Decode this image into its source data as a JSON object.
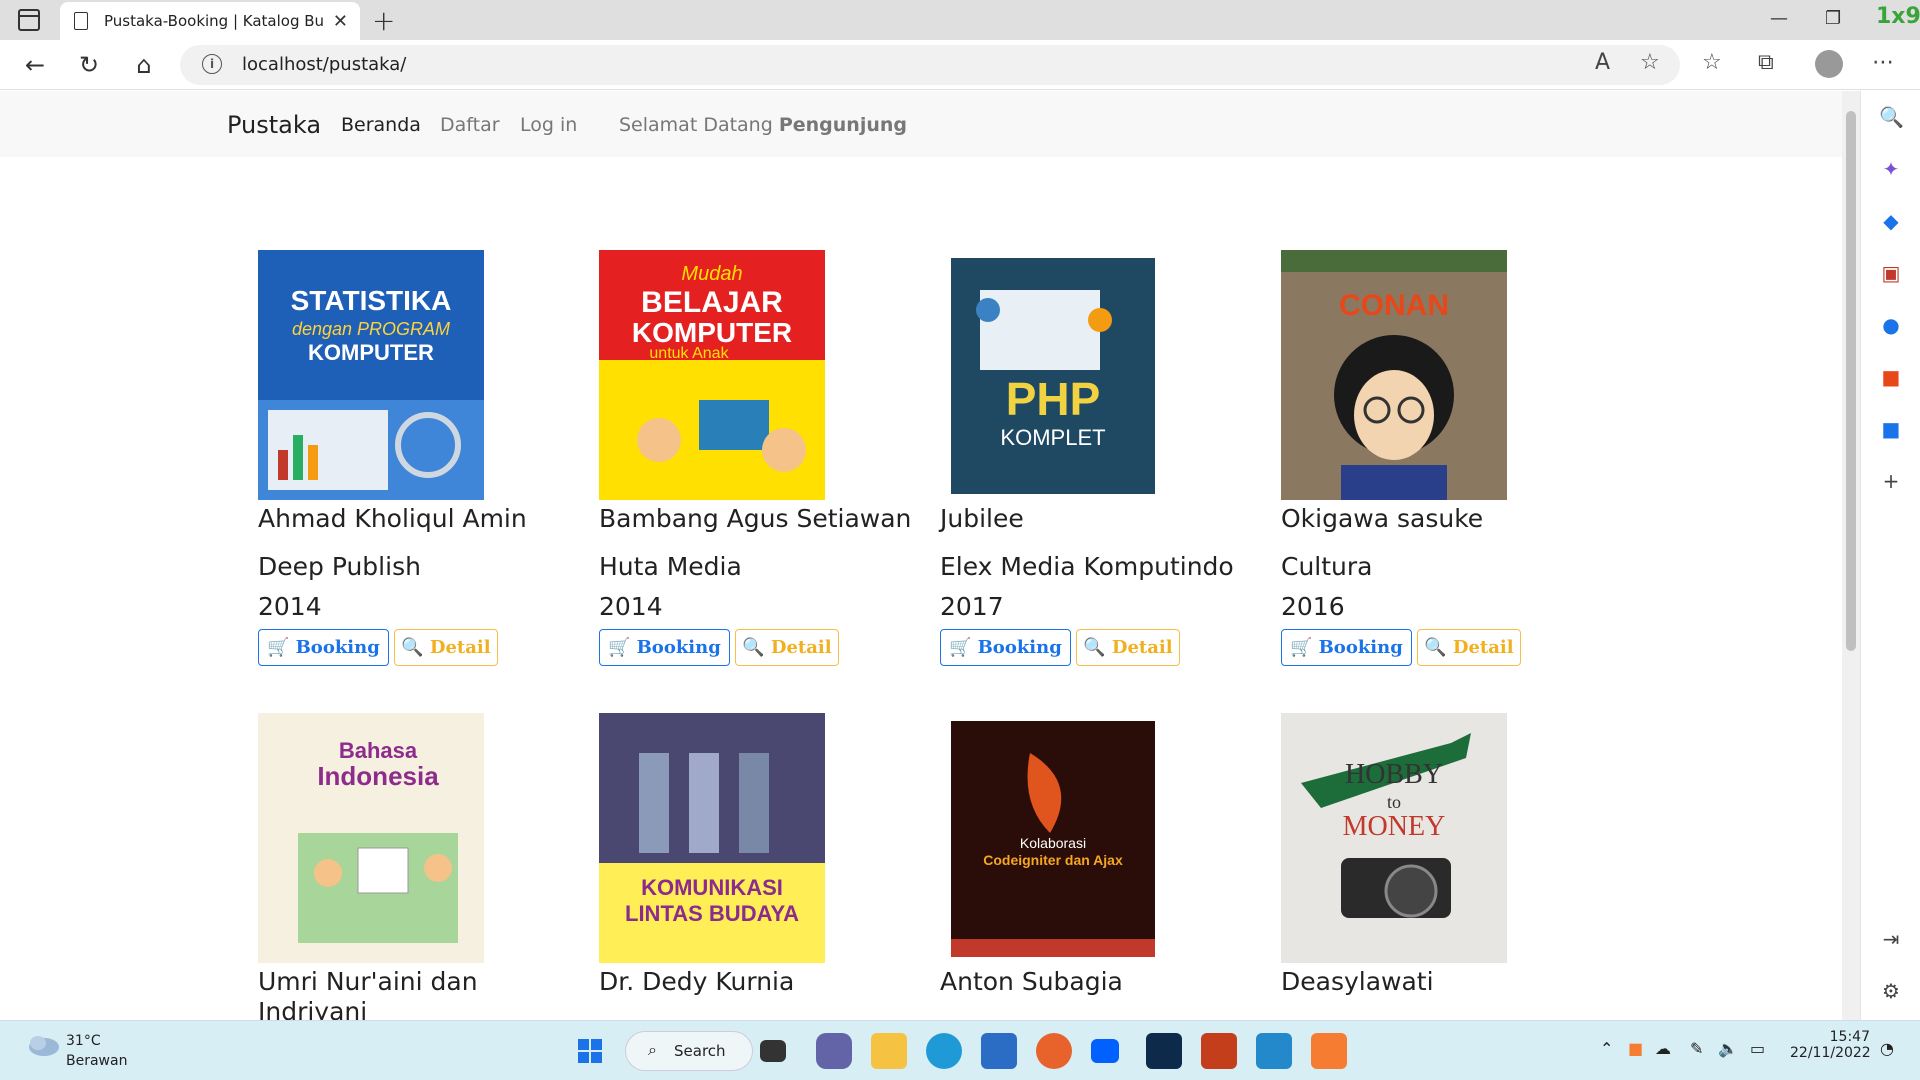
{
  "browser": {
    "tab_title": "Pustaka-Booking | Katalog Buku",
    "url": "localhost/pustaka/",
    "badge": "1x9"
  },
  "navbar": {
    "brand": "Pustaka",
    "links": [
      "Beranda",
      "Daftar",
      "Log in"
    ],
    "welcome_prefix": "Selamat Datang",
    "welcome_user": "Pengunjung"
  },
  "books": [
    {
      "author": "Ahmad Kholiqul Amin",
      "publisher": "Deep Publish",
      "year": "2014",
      "cover_title": "STATISTIKA dengan PROGRAM KOMPUTER"
    },
    {
      "author": "Bambang Agus Setiawan",
      "publisher": "Huta Media",
      "year": "2014",
      "cover_title": "Mudah BELAJAR KOMPUTER untuk Anak"
    },
    {
      "author": "Jubilee",
      "publisher": "Elex Media Komputindo",
      "year": "2017",
      "cover_title": "PHP KOMPLET"
    },
    {
      "author": "Okigawa sasuke",
      "publisher": "Cultura",
      "year": "2016",
      "cover_title": "DETEKTIF CONAN"
    },
    {
      "author": "Umri Nur'aini dan Indriyani",
      "publisher": "",
      "year": "",
      "cover_title": "Bahasa Indonesia"
    },
    {
      "author": "Dr. Dedy Kurnia",
      "publisher": "",
      "year": "",
      "cover_title": "KOMUNIKASI LINTAS BUDAYA"
    },
    {
      "author": "Anton Subagia",
      "publisher": "",
      "year": "",
      "cover_title": "Kolaborasi Codeigniter dan Ajax"
    },
    {
      "author": "Deasylawati",
      "publisher": "",
      "year": "",
      "cover_title": "From HOBBY to MONEY"
    }
  ],
  "buttons": {
    "booking": "Booking",
    "detail": "Detail"
  },
  "taskbar": {
    "weather_temp": "31°C",
    "weather_desc": "Berawan",
    "search_label": "Search",
    "time": "15:47",
    "date": "22/11/2022"
  },
  "colors": {
    "booking": "#1a73e8",
    "detail": "#f0b020",
    "taskbar": "#d7eef4"
  }
}
